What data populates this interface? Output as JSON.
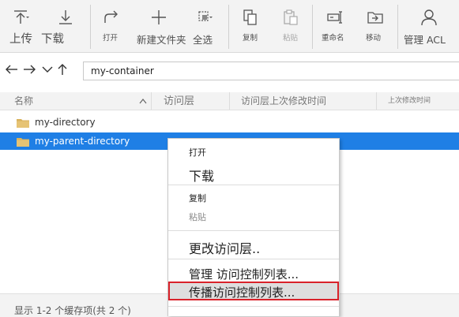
{
  "toolbar": {
    "upload": "上传",
    "download": "下载",
    "open": "打开",
    "new_folder": "新建文件夹",
    "select_all": "全选",
    "copy": "复制",
    "paste": "粘贴",
    "rename": "重命名",
    "move": "移动",
    "manage_acl": "管理 ACL"
  },
  "address": {
    "value": "my-container"
  },
  "columns": {
    "name": "名称",
    "access_tier": "访问层",
    "access_tier_modified": "访问层上次修改时间",
    "last_modified": "上次修改时间"
  },
  "rows": [
    {
      "name": "my-directory",
      "selected": false
    },
    {
      "name": "my-parent-directory",
      "selected": true
    }
  ],
  "status": {
    "text": "显示 1-2 个缓存项(共 2 个)"
  },
  "context_menu": {
    "items": [
      {
        "label": "打开",
        "enabled": true
      },
      {
        "label": "下载",
        "enabled": true
      },
      {
        "label": "复制",
        "enabled": true
      },
      {
        "label": "粘贴",
        "enabled": false
      },
      {
        "label": "更改访问层..",
        "enabled": true
      },
      {
        "label": "管理 访问控制列表...",
        "enabled": true
      },
      {
        "label": "传播访问控制列表...",
        "enabled": true,
        "highlighted": true
      }
    ]
  },
  "colors": {
    "selection": "#1f7fe5",
    "highlight_border": "#d9222a",
    "folder": "#d8b25c"
  }
}
